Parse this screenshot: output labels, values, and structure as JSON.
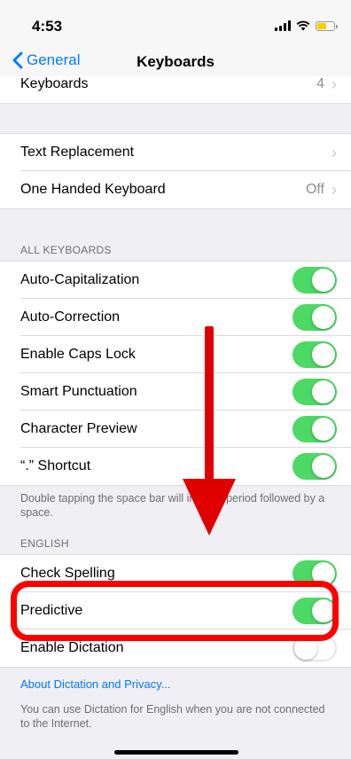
{
  "status": {
    "time": "4:53"
  },
  "nav": {
    "back_label": "General",
    "title": "Keyboards"
  },
  "top_group": {
    "label": "Keyboards",
    "value": "4"
  },
  "group2": [
    {
      "label": "Text Replacement",
      "value": ""
    },
    {
      "label": "One Handed Keyboard",
      "value": "Off"
    }
  ],
  "all_keyboards": {
    "header": "ALL KEYBOARDS",
    "items": [
      {
        "label": "Auto-Capitalization",
        "on": true
      },
      {
        "label": "Auto-Correction",
        "on": true
      },
      {
        "label": "Enable Caps Lock",
        "on": true
      },
      {
        "label": "Smart Punctuation",
        "on": true
      },
      {
        "label": "Character Preview",
        "on": true
      },
      {
        "label": "“.” Shortcut",
        "on": true
      }
    ],
    "footer": "Double tapping the space bar will insert a period followed by a space."
  },
  "english": {
    "header": "ENGLISH",
    "items": [
      {
        "label": "Check Spelling",
        "on": true
      },
      {
        "label": "Predictive",
        "on": true
      },
      {
        "label": "Enable Dictation",
        "on": false
      }
    ],
    "link": "About Dictation and Privacy...",
    "footer": "You can use Dictation for English when you are not connected to the Internet."
  },
  "colors": {
    "accent": "#007aff",
    "toggle_on": "#4cd964",
    "annotation": "#ff0000"
  },
  "icons": {
    "back": "chevron-left-icon",
    "disclosure": "chevron-right-icon",
    "arrow": "arrow-down-annotation-icon"
  }
}
